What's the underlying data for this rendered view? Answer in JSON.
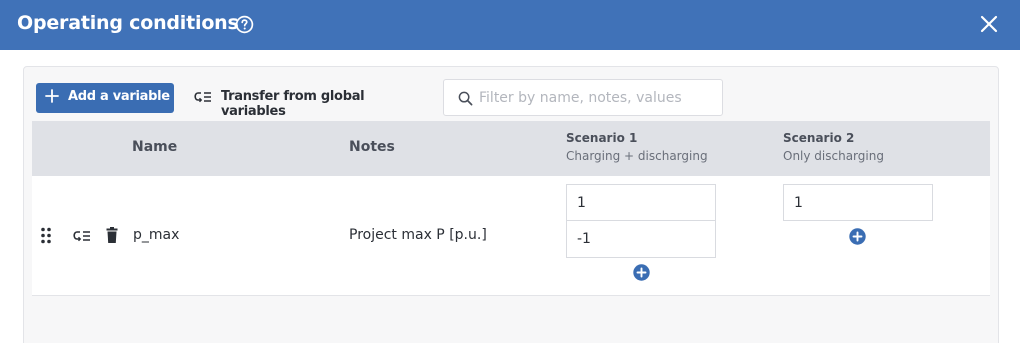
{
  "dialog": {
    "title": "Operating conditions",
    "icons": {
      "help": "help-circle-icon",
      "close": "close-icon"
    }
  },
  "toolbar": {
    "add_variable_label": "Add a variable",
    "add_icon": "plus-icon",
    "transfer_label": "Transfer from global variables",
    "transfer_icon": "transfer-icon",
    "filter_placeholder": "Filter by name, notes, values",
    "filter_value": "",
    "filter_icon": "search-icon"
  },
  "table": {
    "columns": {
      "name": "Name",
      "notes": "Notes",
      "scenarios": [
        {
          "title": "Scenario 1",
          "subtitle": "Charging + discharging"
        },
        {
          "title": "Scenario 2",
          "subtitle": "Only discharging"
        }
      ]
    },
    "rows": [
      {
        "icons": [
          "drag-handle-icon",
          "transfer-icon",
          "trash-icon"
        ],
        "name": "p_max",
        "notes": "Project max P [p.u.]",
        "scenario_values": [
          [
            "1",
            "-1"
          ],
          [
            "1"
          ]
        ],
        "add_value_icon": "add-circle-icon"
      }
    ]
  },
  "colors": {
    "header_bar": "#4072b8",
    "primary_button": "#3a6db3",
    "table_header_bg": "#dfe1e6",
    "panel_bg": "#f7f7f8"
  }
}
